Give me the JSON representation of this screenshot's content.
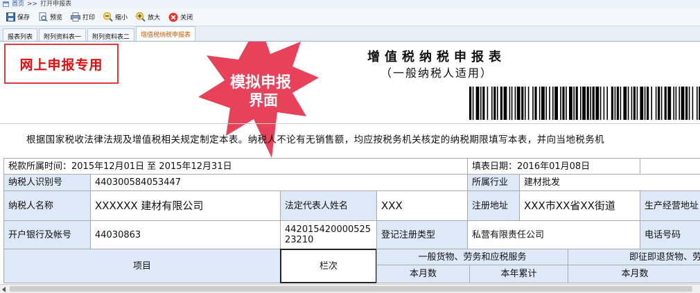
{
  "breadcrumb": {
    "home": "首页",
    "separator": ">>",
    "current": "打开申报表"
  },
  "toolbar": {
    "save": "保存",
    "preview": "预览",
    "print": "打印",
    "zoom_out": "缩小",
    "zoom_in": "放大",
    "close": "关闭"
  },
  "tabs": [
    {
      "label": "报表列表"
    },
    {
      "label": "附列资料表一"
    },
    {
      "label": "附列资料表二"
    },
    {
      "label": "增值税纳税申报表"
    }
  ],
  "stamp": "网上申报专用",
  "callout": {
    "line1": "模拟申报",
    "line2": "界面",
    "color": "#e8425a"
  },
  "form": {
    "title": "增值税纳税申报表",
    "subtitle": "（一般纳税人适用）",
    "intro": "根据国家税收法律法规及增值税相关规定制定本表。纳税人不论有无销售额，均应按税务机关核定的纳税期限填写本表，并向当地税务机",
    "period": "税款所属时间：2015年12月01日  至  2015年12月31日",
    "fill_date": "填表日期：2016年01月08日",
    "taxpayer_id_label": "纳税人识别号",
    "taxpayer_id": "440300584053447",
    "industry_label": "所属行业",
    "industry": "建材批发",
    "taxpayer_name_label": "纳税人名称",
    "taxpayer_name": "XXXXXX 建材有限公司",
    "legal_rep_label": "法定代表人姓名",
    "legal_rep": "XXX",
    "reg_address_label": "注册地址",
    "reg_address": "XXX市XX省XX街道",
    "biz_address_label": "生产经营地址",
    "bank_label": "开户银行及帐号",
    "bank": "44030863",
    "account_no": "44201542000052523210",
    "reg_type_label": "登记注册类型",
    "reg_type": "私营有限责任公司",
    "phone_label": "电话号码",
    "col_item": "项目",
    "col_line": "栏次",
    "col_general": "一般货物、劳务和应税服务",
    "col_refund": "即征即退货物、劳",
    "col_month": "本月数",
    "col_year": "本年累计",
    "col_month2": "本月数"
  },
  "colors": {
    "accent": "#dde9f7",
    "stamp_red": "#e20d0d"
  }
}
